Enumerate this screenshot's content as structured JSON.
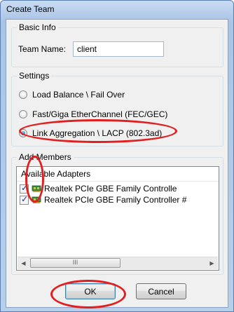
{
  "window": {
    "title": "Create Team"
  },
  "basic_info": {
    "group_title": "Basic Info",
    "team_name_label": "Team Name:",
    "team_name_value": "client"
  },
  "settings": {
    "group_title": "Settings",
    "options": [
      {
        "label": "Load Balance \\ Fail Over",
        "selected": false
      },
      {
        "label": "Fast/Giga EtherChannel (FEC/GEC)",
        "selected": false
      },
      {
        "label": "Link Aggregation \\ LACP (802.3ad)",
        "selected": true
      }
    ]
  },
  "members": {
    "group_title": "Add Members",
    "list_header": "Available Adapters",
    "adapters": [
      {
        "label": "Realtek PCIe GBE Family Controlle",
        "checked": true
      },
      {
        "label": "Realtek PCIe GBE Family Controller #",
        "checked": true
      }
    ],
    "scroll_thumb_grip": "III"
  },
  "buttons": {
    "ok": "OK",
    "cancel": "Cancel"
  },
  "colors": {
    "annotation": "#e02020",
    "accent": "#1a6fb5"
  }
}
